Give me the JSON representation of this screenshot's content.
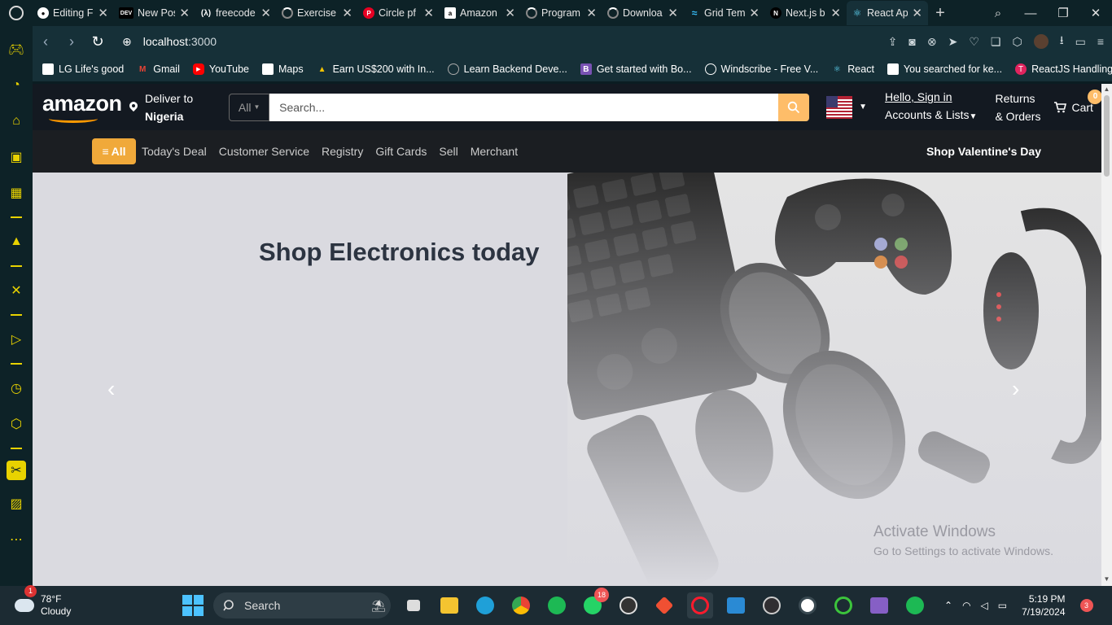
{
  "browser": {
    "tabs": [
      {
        "label": "Editing F",
        "icon": "github-icon",
        "active": false
      },
      {
        "label": "New Pos",
        "icon": "dev-icon",
        "active": false
      },
      {
        "label": "freecode",
        "icon": "freecodecamp-icon",
        "active": false
      },
      {
        "label": "Exercise",
        "icon": "loading-icon",
        "active": false
      },
      {
        "label": "Circle pf",
        "icon": "pinterest-icon",
        "active": false
      },
      {
        "label": "Amazon",
        "icon": "amazon-icon",
        "active": false
      },
      {
        "label": "Program",
        "icon": "loading-icon",
        "active": false
      },
      {
        "label": "Downloa",
        "icon": "loading-icon",
        "active": false
      },
      {
        "label": "Grid Tem",
        "icon": "tailwind-icon",
        "active": false
      },
      {
        "label": "Next.js b",
        "icon": "nextjs-icon",
        "active": false
      },
      {
        "label": "React Ap",
        "icon": "react-icon",
        "active": true
      }
    ],
    "url": {
      "host": "localhost",
      "port": ":3000"
    },
    "bookmarks": [
      {
        "label": "LG Life's good",
        "icon": "page-icon"
      },
      {
        "label": "Gmail",
        "icon": "gmail-icon"
      },
      {
        "label": "YouTube",
        "icon": "youtube-icon"
      },
      {
        "label": "Maps",
        "icon": "page-icon"
      },
      {
        "label": "Earn US$200 with In...",
        "icon": "airdrop-icon"
      },
      {
        "label": "Learn Backend Deve...",
        "icon": "page-icon"
      },
      {
        "label": "Get started with Bo...",
        "icon": "bootstrap-icon"
      },
      {
        "label": "Windscribe - Free V...",
        "icon": "windscribe-icon"
      },
      {
        "label": "React",
        "icon": "react-icon"
      },
      {
        "label": "You searched for ke...",
        "icon": "page-icon"
      },
      {
        "label": "ReactJS Handling Ev...",
        "icon": "reactjs-icon"
      }
    ]
  },
  "amazon": {
    "logo": "amazon",
    "deliver": {
      "label": "Deliver to",
      "country": "Nigeria"
    },
    "search": {
      "category": "All",
      "placeholder": "Search..."
    },
    "account": {
      "greeting": "Hello, Sign in",
      "label": "Accounts & Lists"
    },
    "returns": {
      "line1": "Returns",
      "line2": "& Orders"
    },
    "cart": {
      "label": "Cart",
      "count": "0"
    },
    "subnav": {
      "all": "All",
      "links": [
        "Today's Deal",
        "Customer Service",
        "Registry",
        "Gift Cards",
        "Sell",
        "Merchant"
      ],
      "promo": "Shop Valentine's Day"
    },
    "hero": {
      "title": "Shop Electronics today"
    }
  },
  "watermark": {
    "title": "Activate Windows",
    "subtitle": "Go to Settings to activate Windows."
  },
  "taskbar": {
    "weather": {
      "temp": "78°F",
      "condition": "Cloudy",
      "badge": "1"
    },
    "search_label": "Search",
    "whatsapp_badge": "18",
    "time": "5:19 PM",
    "date": "7/19/2024",
    "notifications": "3"
  },
  "colors": {
    "accent": "#febd69",
    "header": "#131921",
    "all_button": "#f0a93a",
    "sidebar_icon": "#e8d200"
  }
}
